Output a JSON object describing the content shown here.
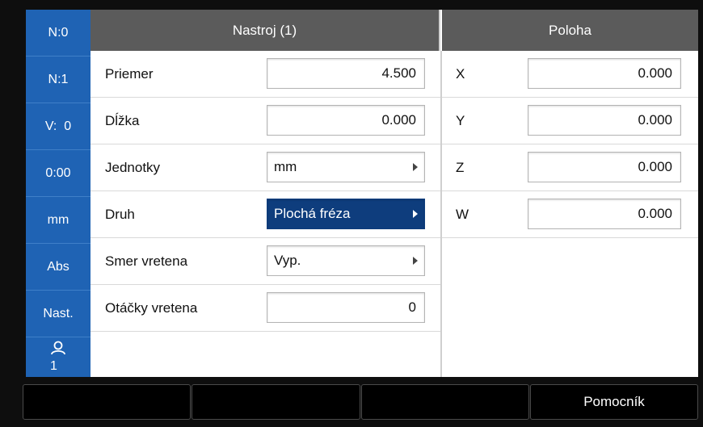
{
  "sidebar": {
    "items": [
      {
        "label": "N:0"
      },
      {
        "label": "N:1"
      },
      {
        "label": "V:  0"
      },
      {
        "label": "0:00"
      },
      {
        "label": "mm"
      },
      {
        "label": "Abs"
      },
      {
        "label": "Nast."
      },
      {
        "label": "1",
        "icon": "user-icon"
      }
    ]
  },
  "tool_panel": {
    "title": "Nastroj (1)",
    "rows": [
      {
        "label": "Priemer",
        "value": "4.500"
      },
      {
        "label": "Dĺžka",
        "value": "0.000"
      },
      {
        "label": "Jednotky",
        "value": "mm"
      },
      {
        "label": "Druh",
        "value": "Plochá fréza"
      },
      {
        "label": "Smer vretena",
        "value": "Vyp."
      },
      {
        "label": "Otáčky vretena",
        "value": "0"
      }
    ]
  },
  "position_panel": {
    "title": "Poloha",
    "rows": [
      {
        "label": "X",
        "value": "0.000"
      },
      {
        "label": "Y",
        "value": "0.000"
      },
      {
        "label": "Z",
        "value": "0.000"
      },
      {
        "label": "W",
        "value": "0.000"
      }
    ]
  },
  "softkeys": [
    "",
    "",
    "",
    "Pomocník"
  ],
  "colors": {
    "sidebar": "#1f63b4",
    "header": "#5b5b5b",
    "selected_field": "#0e3d7d",
    "frame": "#0e0e0e"
  }
}
